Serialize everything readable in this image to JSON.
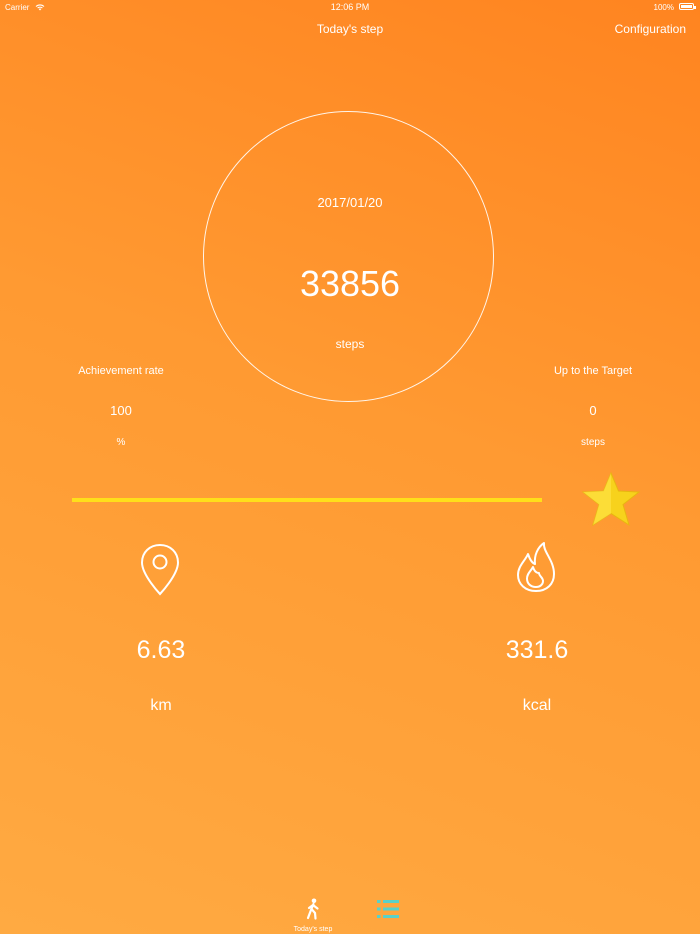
{
  "status_bar": {
    "carrier": "Carrier",
    "time": "12:06 PM",
    "battery": "100%"
  },
  "nav": {
    "title": "Today's step",
    "configuration_label": "Configuration"
  },
  "summary": {
    "date": "2017/01/20",
    "steps_count": "33856",
    "steps_unit": "steps"
  },
  "achievement": {
    "label": "Achievement rate",
    "value": "100",
    "unit": "%"
  },
  "target": {
    "label": "Up to the Target",
    "value": "0",
    "unit": "steps"
  },
  "progress": {
    "fraction": 1.0,
    "color": "#ffdf1a"
  },
  "distance": {
    "icon": "location-pin-icon",
    "value": "6.63",
    "unit": "km"
  },
  "calories": {
    "icon": "flame-icon",
    "value": "331.6",
    "unit": "kcal"
  },
  "tab_bar": {
    "today_label": "Today's step",
    "list_icon_color": "#5ad1c8"
  },
  "colors": {
    "background_top": "#ff8420",
    "background_bottom": "#ffaa42",
    "star": "#f7d21c"
  }
}
